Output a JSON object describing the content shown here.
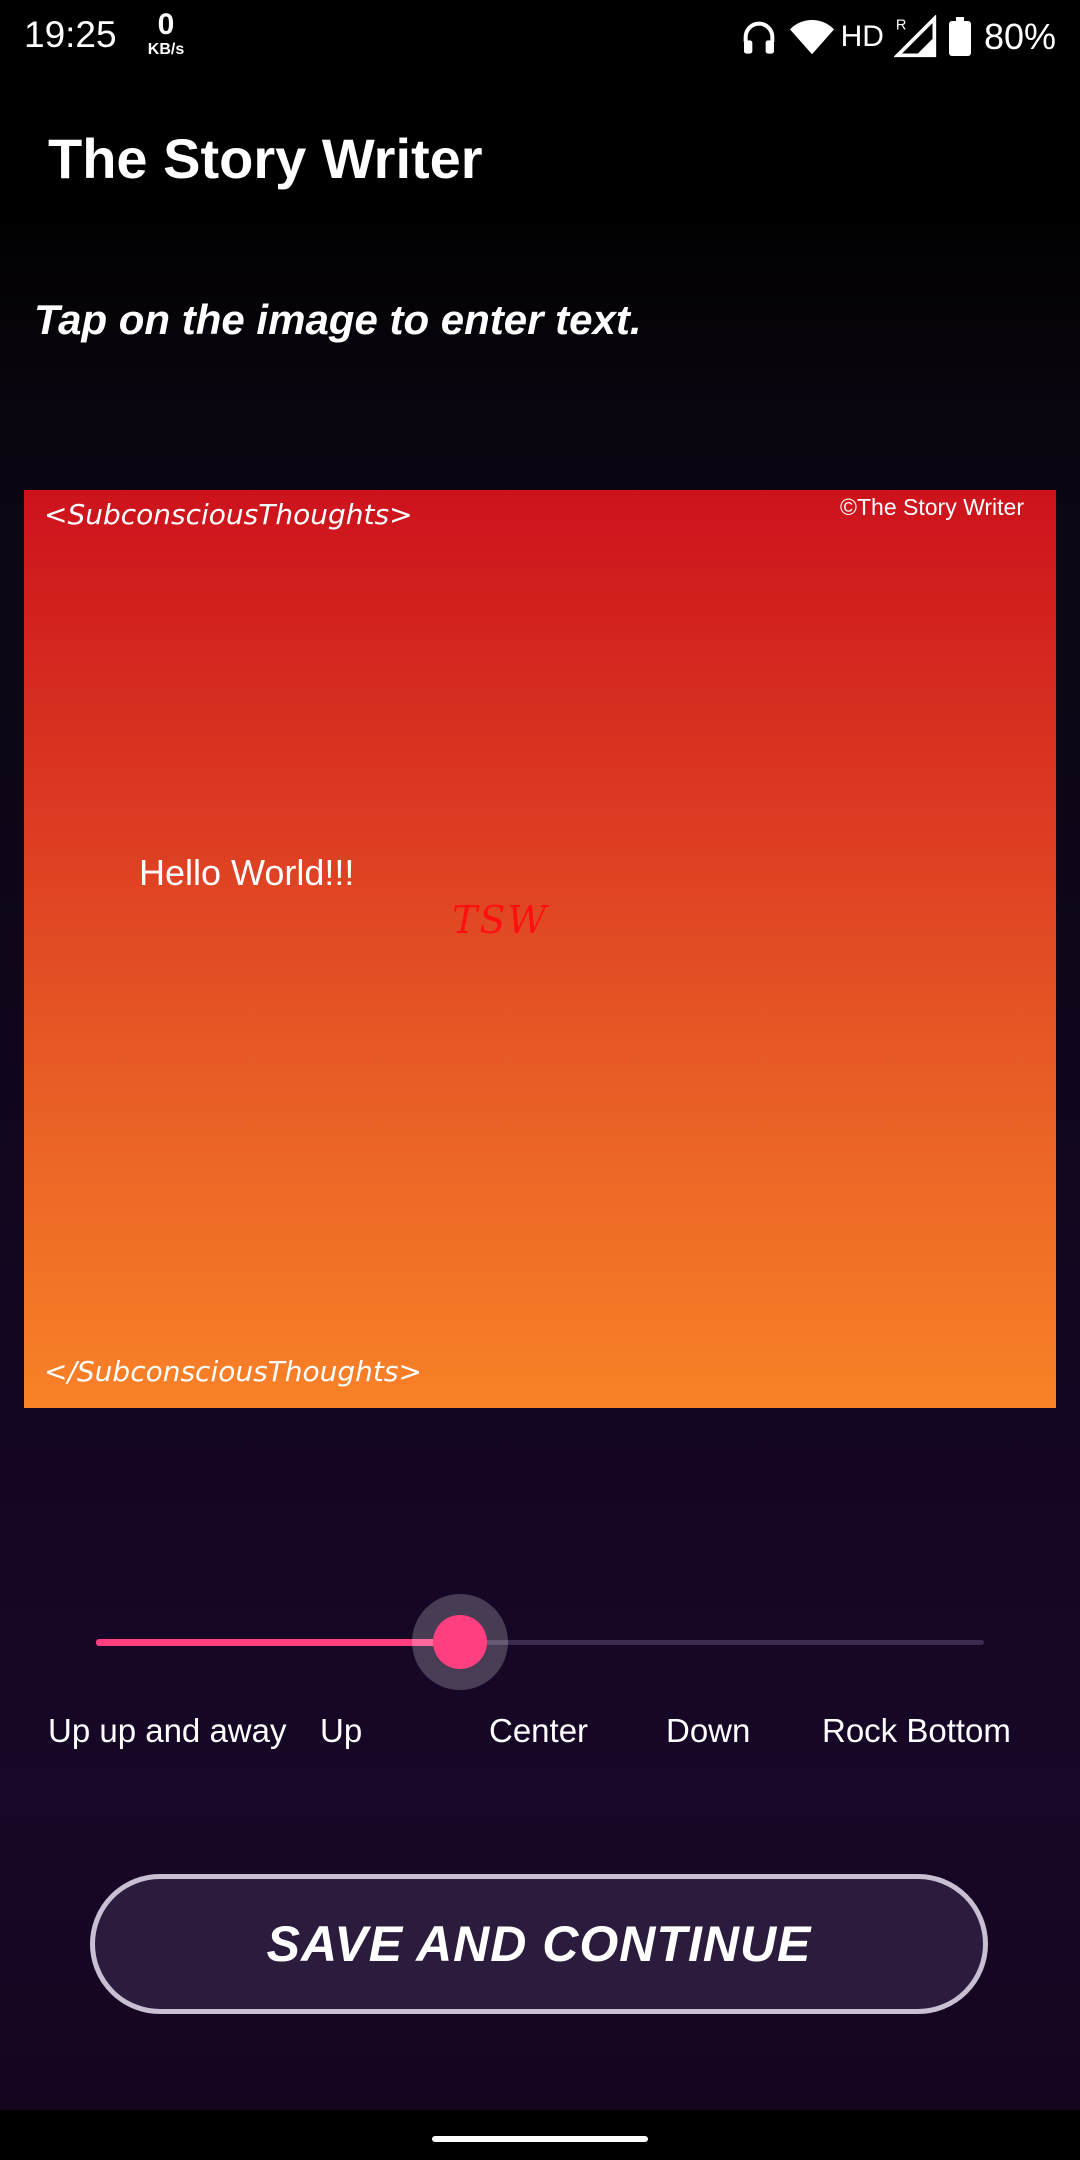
{
  "status_bar": {
    "time": "19:25",
    "net_speed": "0",
    "net_unit": "KB/s",
    "network_label": "HD",
    "roaming": "R",
    "battery": "80%"
  },
  "app": {
    "title": "The Story Writer",
    "instruction": "Tap on the image to enter text."
  },
  "story_image": {
    "tag_open": "<SubconsciousThoughts>",
    "tag_close": "</SubconsciousThoughts>",
    "copyright": "©The Story Writer",
    "text": "Hello World!!!",
    "watermark": "TSW",
    "gradient_top": "#cd121c",
    "gradient_bottom": "#f98227"
  },
  "position_slider": {
    "value_fraction": 0.41,
    "labels": [
      "Up up and away",
      "Up",
      "Center",
      "Down",
      "Rock Bottom"
    ],
    "accent": "#ff3f7f"
  },
  "save_button": {
    "label": "SAVE AND CONTINUE"
  }
}
